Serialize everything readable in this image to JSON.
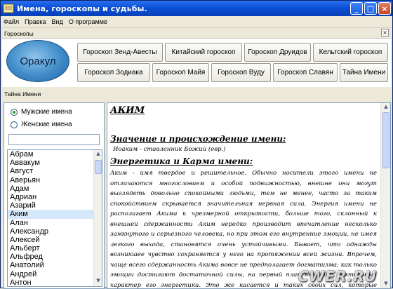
{
  "window": {
    "title": "Имена, гороскопы и судьбы."
  },
  "menu": [
    "Файл",
    "Правка",
    "Вид",
    "О программе"
  ],
  "horoscopes": {
    "label": "Гороскопы",
    "close_glyph": "×",
    "oracle_label": "Оракул",
    "row1": [
      "Гороскоп Зенд-Авесты",
      "Китайский гороскоп",
      "Гороскоп Друидов",
      "Кельтский гороскоп"
    ],
    "row2": [
      "Гороскоп Зодиака",
      "Гороскоп Майя",
      "Гороскоп Вуду",
      "Гороскоп Славян",
      "Тайна Имени"
    ]
  },
  "names_panel": {
    "label": "Тайна Имени",
    "radio_male": "Мужские имена",
    "radio_female": "Женские имена",
    "selected_gender": "male",
    "filter_value": "",
    "names": [
      "Абрам",
      "Аввакум",
      "Август",
      "Аверьян",
      "Адам",
      "Адриан",
      "Азарий",
      "Аким",
      "Алан",
      "Александр",
      "Алексей",
      "Альберт",
      "Альфред",
      "Анатолий",
      "Андрей",
      "Антон"
    ],
    "selected_name": "Аким"
  },
  "content": {
    "name": "АКИМ",
    "section1_title": "Значение и происхождение имени:",
    "meaning": "Иоаким - ставленник Божий (евр.)",
    "section2_title": "Энергетика и Карма имени:",
    "body": "Аким - имя твердое и решительное. Обычно носители этого имени не отличаются многословием и особой подвижностью, внешне они могут выглядеть довольно спокойными людьми, тем не менее, часто за таким спокойствием скрывается значительная нервная сила. Энергия имени не располагает Акима к чрезмерной открытости, больше того, склонный к внешней сдержанности Аким нередко производит впечатление несколько замкнутого и серьезного человека, но при этом его внутренние эмоции, не имея легкого выхода, становятся очень устойчивыми. Бывает, что однажды возникшее чувство сохраняется у него на протяжении всей жизни. Впрочем, чаще всего сдержанность Акима вовсе не предполагает догматизма: как только эмоции достигают достаточной силы, на первый план выходит деятельный характер его энергетики. Это же касается и таких своих сил, которые временами приобретают характер безпредельной энергии."
  },
  "watermark": "CWER.RU",
  "colors": {
    "titlebar": "#0a4fd6",
    "selection": "#d6e8fb",
    "oracle": "#3f8bc8"
  }
}
